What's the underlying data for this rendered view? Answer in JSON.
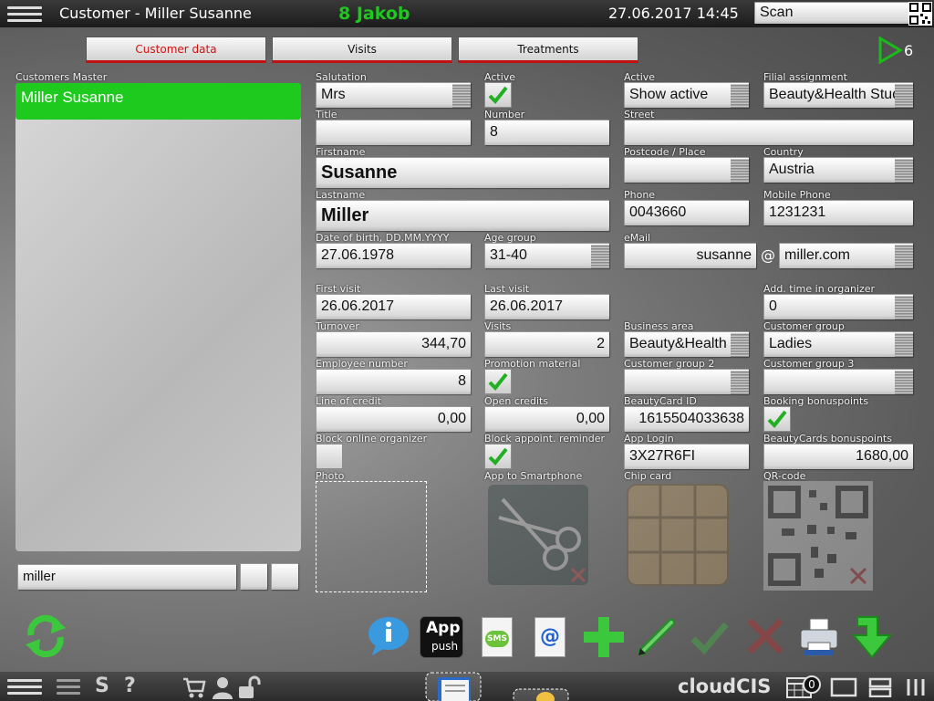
{
  "topbar": {
    "title": "Customer - Miller Susanne",
    "employee": "8 Jakob",
    "datetime": "27.06.2017 14:45",
    "scan_value": "Scan"
  },
  "tabs": [
    "Customer data",
    "Visits",
    "Treatments"
  ],
  "play_count": "6",
  "customers_master": {
    "label": "Customers Master",
    "selected": "Miller Susanne",
    "search_value": "miller"
  },
  "fields": {
    "salutation": {
      "label": "Salutation",
      "value": "Mrs"
    },
    "active1": {
      "label": "Active"
    },
    "active2": {
      "label": "Active",
      "value": "Show active"
    },
    "filial": {
      "label": "Filial assignment",
      "value": "Beauty&Health Studio"
    },
    "title": {
      "label": "Title",
      "value": ""
    },
    "number": {
      "label": "Number",
      "value": "8"
    },
    "street": {
      "label": "Street",
      "value": ""
    },
    "firstname": {
      "label": "Firstname",
      "value": "Susanne"
    },
    "postcode": {
      "label": "Postcode / Place",
      "value": ""
    },
    "country": {
      "label": "Country",
      "value": "Austria"
    },
    "lastname": {
      "label": "Lastname",
      "value": "Miller"
    },
    "phone": {
      "label": "Phone",
      "value": "0043660"
    },
    "mobile": {
      "label": "Mobile Phone",
      "value": "1231231"
    },
    "dob": {
      "label": "Date of birth, DD.MM.YYYY",
      "value": "27.06.1978"
    },
    "agegroup": {
      "label": "Age group",
      "value": "31-40"
    },
    "email": {
      "label": "eMail",
      "user": "susanne",
      "at": "@",
      "domain": "miller.com"
    },
    "firstvisit": {
      "label": "First visit",
      "value": "26.06.2017"
    },
    "lastvisit": {
      "label": "Last visit",
      "value": "26.06.2017"
    },
    "addtime": {
      "label": "Add. time in organizer",
      "value": "0"
    },
    "turnover": {
      "label": "Turnover",
      "value": "344,70"
    },
    "visits": {
      "label": "Visits",
      "value": "2"
    },
    "businessarea": {
      "label": "Business area",
      "value": "Beauty&Health"
    },
    "custgroup": {
      "label": "Customer group",
      "value": "Ladies"
    },
    "employeenum": {
      "label": "Employee number",
      "value": "8"
    },
    "promotion": {
      "label": "Promotion material"
    },
    "custgroup2": {
      "label": "Customer group 2",
      "value": ""
    },
    "custgroup3": {
      "label": "Customer group 3",
      "value": ""
    },
    "credit": {
      "label": "Line of credit",
      "value": "0,00"
    },
    "opencredits": {
      "label": "Open credits",
      "value": "0,00"
    },
    "beautycard": {
      "label": "BeautyCard ID",
      "value": "1615504033638"
    },
    "bonuspoints": {
      "label": "Booking bonuspoints"
    },
    "blockonline": {
      "label": "Block online organizer"
    },
    "blockreminder": {
      "label": "Block appoint. reminder"
    },
    "applogin": {
      "label": "App Login",
      "value": "3X27R6FI"
    },
    "bcbonus": {
      "label": "BeautyCards bonuspoints",
      "value": "1680,00"
    },
    "photo": {
      "label": "Photo"
    },
    "appsmart": {
      "label": "App to Smartphone"
    },
    "chipcard": {
      "label": "Chip card"
    },
    "qrcode": {
      "label": "QR-code"
    }
  },
  "toolbar": {
    "app_label": "App",
    "push_label": "push",
    "sms_label": "SMS",
    "at_label": "@"
  },
  "bottom": {
    "brand": "cloudCIS",
    "s_label": "S",
    "help_label": "?",
    "calendar_count": "0"
  },
  "colors": {
    "green": "#1aba1a",
    "accent_red": "#c01010"
  }
}
